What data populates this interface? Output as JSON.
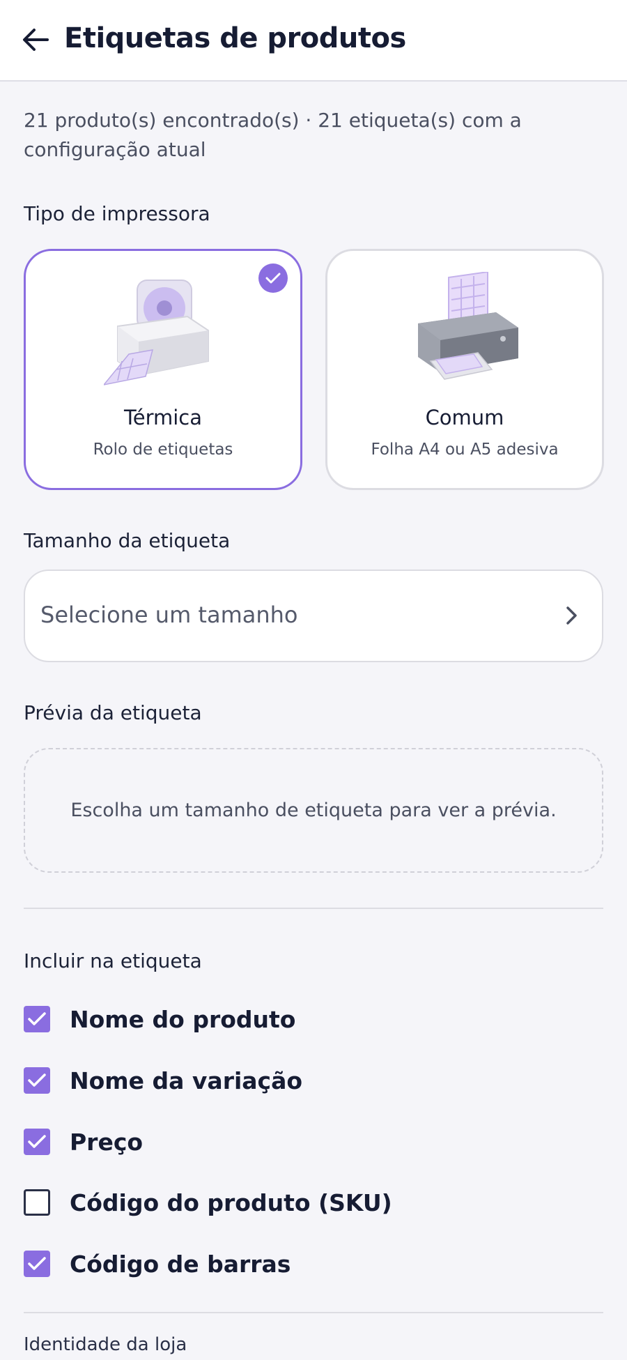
{
  "header": {
    "title": "Etiquetas de produtos"
  },
  "summary": "21 produto(s) encontrado(s) · 21 etiqueta(s) com a configuração atual",
  "printer_type": {
    "label": "Tipo de impressora",
    "options": [
      {
        "title": "Térmica",
        "subtitle": "Rolo de etiquetas",
        "selected": true
      },
      {
        "title": "Comum",
        "subtitle": "Folha A4 ou A5 adesiva",
        "selected": false
      }
    ]
  },
  "label_size": {
    "label": "Tamanho da etiqueta",
    "placeholder": "Selecione um tamanho"
  },
  "preview": {
    "label": "Prévia da etiqueta",
    "message": "Escolha um tamanho de etiqueta para ver a prévia."
  },
  "include": {
    "label": "Incluir na etiqueta",
    "items": [
      {
        "label": "Nome do produto",
        "checked": true
      },
      {
        "label": "Nome da variação",
        "checked": true
      },
      {
        "label": "Preço",
        "checked": true
      },
      {
        "label": "Código do produto (SKU)",
        "checked": false
      },
      {
        "label": "Código de barras",
        "checked": true
      }
    ]
  },
  "store_identity": {
    "label": "Identidade da loja"
  },
  "colors": {
    "accent": "#8a6de0",
    "text": "#161c33",
    "background": "#f5f5f9"
  }
}
